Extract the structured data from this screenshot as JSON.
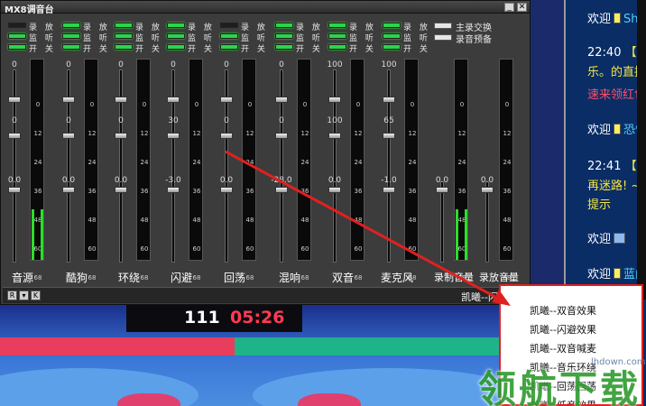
{
  "window": {
    "title": "MX8调音台",
    "minimize": "_",
    "close": "✕"
  },
  "header_labels": {
    "rec": "录 放",
    "mon": "监 听",
    "sw": "开 关"
  },
  "channels": [
    {
      "name": "音源",
      "top_val": "0",
      "mid_val": "0",
      "bot_val": "0.0",
      "rec_led": "off",
      "mon_led": "on",
      "sw_led": "on",
      "level": 0.25
    },
    {
      "name": "酷狗",
      "top_val": "0",
      "mid_val": "0",
      "bot_val": "0.0",
      "rec_led": "on",
      "mon_led": "on",
      "sw_led": "on",
      "level": 0
    },
    {
      "name": "环绕",
      "top_val": "0",
      "mid_val": "0",
      "bot_val": "0.0",
      "rec_led": "on",
      "mon_led": "on",
      "sw_led": "on",
      "level": 0
    },
    {
      "name": "闪避",
      "top_val": "0",
      "mid_val": "30",
      "bot_val": "-3.0",
      "rec_led": "on",
      "mon_led": "on",
      "sw_led": "on",
      "level": 0
    },
    {
      "name": "回荡",
      "top_val": "0",
      "mid_val": "0",
      "bot_val": "0.0",
      "rec_led": "off",
      "mon_led": "on",
      "sw_led": "on",
      "level": 0
    },
    {
      "name": "混响",
      "top_val": "0",
      "mid_val": "0",
      "bot_val": "-28.0",
      "rec_led": "on",
      "mon_led": "on",
      "sw_led": "on",
      "level": 0
    },
    {
      "name": "双音",
      "top_val": "100",
      "mid_val": "100",
      "bot_val": "0.0",
      "rec_led": "on",
      "mon_led": "on",
      "sw_led": "on",
      "level": 0
    },
    {
      "name": "麦克风",
      "top_val": "100",
      "mid_val": "65",
      "bot_val": "-1.0",
      "rec_led": "on",
      "mon_led": "on",
      "sw_led": "on",
      "level": 0
    }
  ],
  "switches": {
    "main_rec": "主录交换",
    "rec_preview": "录音预备"
  },
  "meter_ticks": [
    "0",
    "12",
    "24",
    "36",
    "48",
    "60",
    "68"
  ],
  "masters": [
    {
      "name": "录制音量",
      "value": "0.0",
      "level": 0.25
    },
    {
      "name": "录放音量",
      "value": "0.0",
      "level": 0
    }
  ],
  "bottom": {
    "btn_r": "R",
    "btn_down": "▾",
    "btn_k": "K",
    "status": "凯曦--闪避效果"
  },
  "video": {
    "score_left": "111",
    "score_time": "05:26"
  },
  "chat": [
    {
      "a": "欢迎",
      "b": "Shi"
    },
    {
      "a": "22:40",
      "b": "【系"
    },
    {
      "a": "乐。的直播"
    },
    {
      "a": "速来领红包!"
    },
    {
      "a": "欢迎",
      "b": "恐惧"
    },
    {
      "a": "22:41",
      "b": "【系"
    },
    {
      "a": "再迷路! ~如"
    },
    {
      "a": "提示"
    },
    {
      "a": "欢迎",
      "b": ""
    },
    {
      "a": "欢迎",
      "b": "蓝曲"
    }
  ],
  "popup_items": [
    "凯曦--双音效果",
    "凯曦--闪避效果",
    "凯曦--双音喊麦",
    "凯曦--音乐环绕",
    "凯曦--回荡回荡",
    "凯曦--低音效果"
  ],
  "watermark": {
    "logo": "领航下载",
    "site": "lhdown.com"
  },
  "colors": {
    "panel": "#3c3c3c",
    "led_on": "#2bd34e",
    "meter_fill": "#28e02a",
    "score_time": "#ff3b52",
    "chat_bg": "#0a2d66",
    "arrow": "#e02020"
  }
}
